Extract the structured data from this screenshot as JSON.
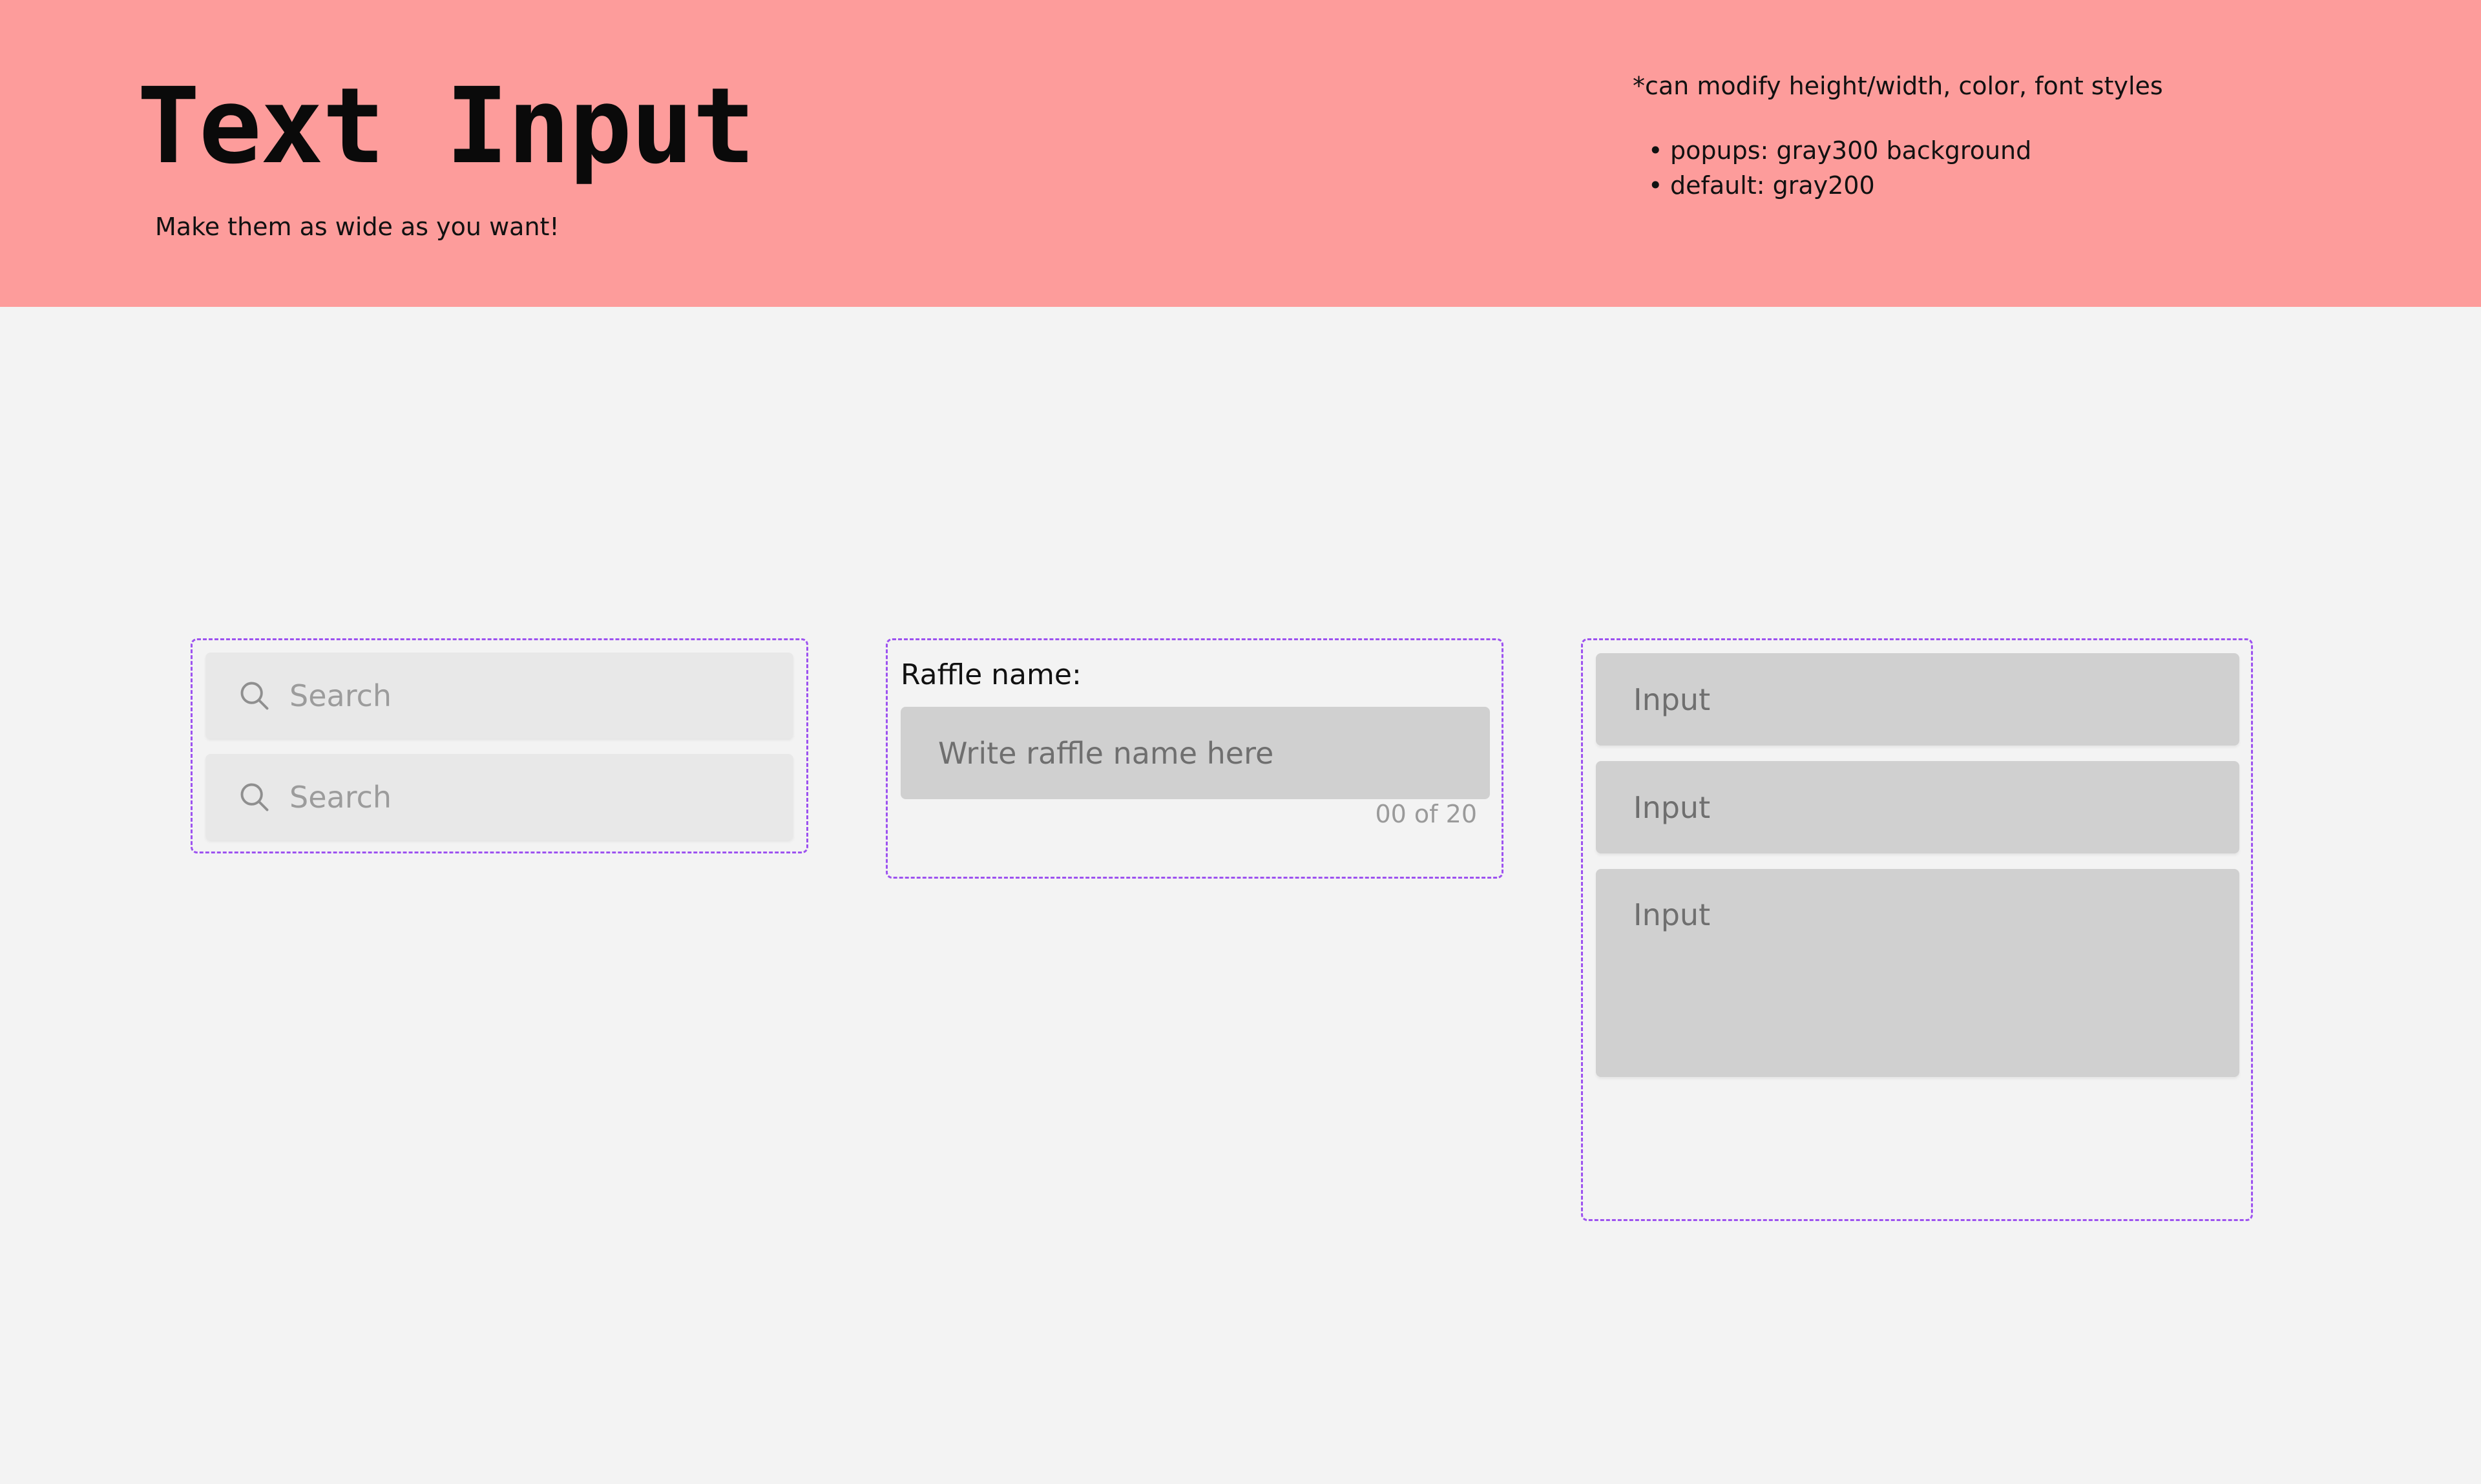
{
  "header": {
    "title": "Text Input",
    "subtitle": "Make them as wide as you want!",
    "background_color": "#fd9c9b"
  },
  "notes": {
    "title": "*can modify height/width, color, font styles",
    "items": [
      {
        "bullet": "•",
        "text": "popups: gray300 background"
      },
      {
        "bullet": "•",
        "text": "default: gray200"
      }
    ]
  },
  "search_group": {
    "icon": "search-icon",
    "inputs": [
      {
        "placeholder": "Search"
      },
      {
        "placeholder": "Search"
      }
    ]
  },
  "raffle_group": {
    "label": "Raffle name:",
    "placeholder": "Write raffle name here",
    "counter": "00 of 20"
  },
  "input_group": {
    "inputs": [
      {
        "placeholder": "Input"
      },
      {
        "placeholder": "Input"
      },
      {
        "placeholder": "Input"
      }
    ]
  },
  "colors": {
    "frame_border": "#9d52f0",
    "gray200": "#e8e8e8",
    "gray300": "#d0d0d0",
    "canvas": "#f3f3f3"
  }
}
